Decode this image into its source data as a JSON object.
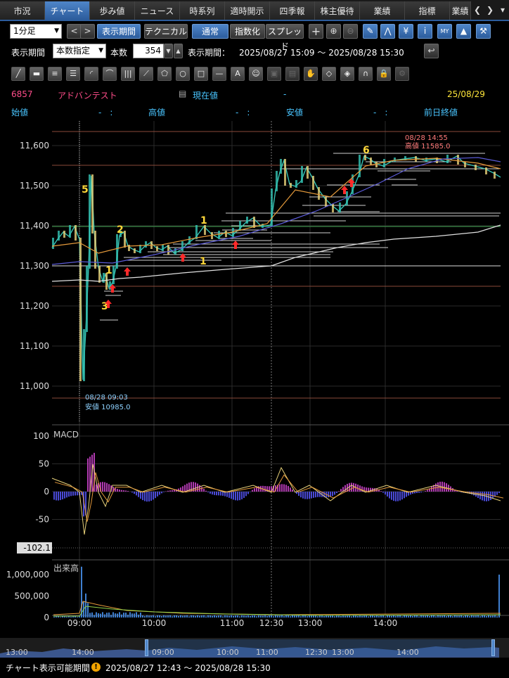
{
  "tabs": [
    "市況",
    "チャート",
    "歩み値",
    "ニュース",
    "時系列",
    "適時開示",
    "四季報",
    "株主優待",
    "業績",
    "指標",
    "業績"
  ],
  "active_tab": 1,
  "toolbar": {
    "interval": "1分足",
    "period_button": "表示期間",
    "technical_button": "テクニカル",
    "normal_button": "通常",
    "index_button": "指数化",
    "spread_button": "スプレッド"
  },
  "period_row": {
    "label": "表示期間",
    "mode": "本数指定",
    "count_label": "本数",
    "count": "354",
    "range_label": "表示期間：",
    "range": "2025/08/27 15:09 〜 2025/08/28 15:30"
  },
  "drawing_tools": [
    "trend-line",
    "ruler",
    "horizontal-lines",
    "parallel-lines",
    "arc",
    "fibonacci",
    "vertical-lines",
    "fan",
    "pentagon",
    "circle",
    "rectangle",
    "horizontal-line",
    "text",
    "stamp",
    "copy",
    "paste",
    "hand",
    "eraser",
    "eraser-all",
    "magnet",
    "lock",
    "settings"
  ],
  "stock": {
    "code": "6857",
    "name": "アドバンテスト",
    "current_label": "現在値",
    "current_value": "-",
    "date": "25/08/29",
    "open_label": "始値",
    "open_value": "-　:",
    "high_label": "高値",
    "high_value": "-　:",
    "low_label": "安値",
    "low_value": "-　:",
    "prev_close_label": "前日終値"
  },
  "price_axis": [
    "11,600",
    "11,500",
    "11,400",
    "11,300",
    "11,200",
    "11,100",
    "11,000"
  ],
  "annotations": {
    "high_time": "08/28 14:55",
    "high_text": "高値 11585.0",
    "low_time": "08/28 09:03",
    "low_text": "安値 10985.0",
    "wave_labels": [
      "5",
      "2",
      "1",
      "3",
      "1",
      "1",
      "6"
    ]
  },
  "macd": {
    "label": "MACD",
    "axis": [
      "100",
      "50",
      "0",
      "-50"
    ],
    "current": "-102.1"
  },
  "volume": {
    "label": "出来高",
    "axis": [
      "1,000,000",
      "500,000",
      "0"
    ]
  },
  "time_axis": [
    "09:00",
    "10:00",
    "11:00",
    "12:30",
    "13:00",
    "14:00"
  ],
  "navigator_axis": [
    "13:00",
    "14:00",
    "09:00",
    "10:00",
    "11:00",
    "12:30",
    "13:00",
    "14:00"
  ],
  "footer": {
    "label": "チャート表示可能期間",
    "range": "2025/08/27 12:43 〜 2025/08/28 15:30"
  },
  "colors": {
    "active_tab": "#2c5c9c",
    "stock_name": "#ff4d8a",
    "header_labels": "#49c5ff",
    "date": "#ffe63a",
    "annotation_low": "#8fd2ff",
    "annotation_high": "#ff7a7a",
    "wave_label": "#ffd83a",
    "up_arrow": "#ff2a2a"
  }
}
